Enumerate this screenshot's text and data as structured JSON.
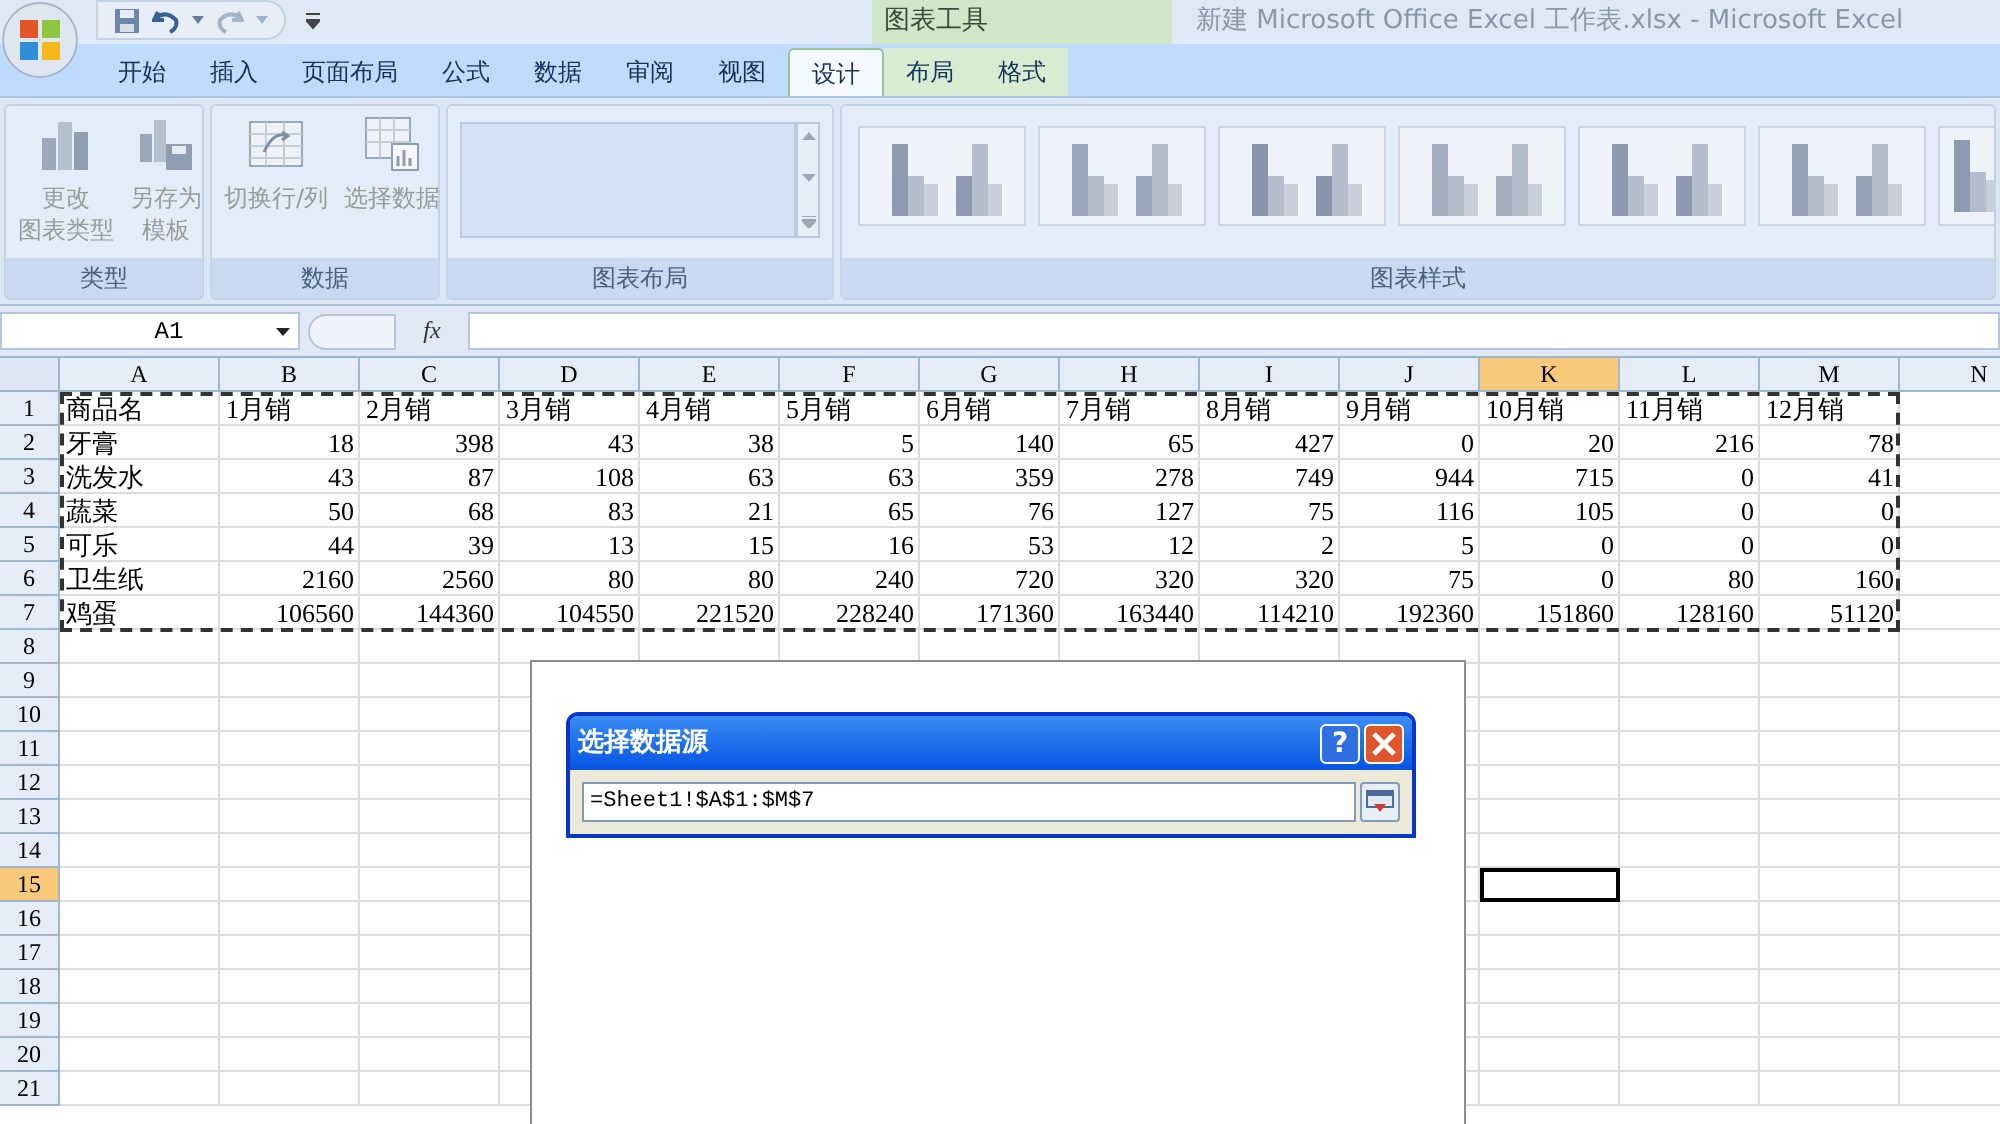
{
  "title_bar": {
    "context_group": "图表工具",
    "title": "新建 Microsoft Office Excel 工作表.xlsx - Microsoft Excel"
  },
  "tabs": [
    {
      "label": "开始",
      "selected": false,
      "kind": "main"
    },
    {
      "label": "插入",
      "selected": false,
      "kind": "main"
    },
    {
      "label": "页面布局",
      "selected": false,
      "kind": "main"
    },
    {
      "label": "公式",
      "selected": false,
      "kind": "main"
    },
    {
      "label": "数据",
      "selected": false,
      "kind": "main"
    },
    {
      "label": "审阅",
      "selected": false,
      "kind": "main"
    },
    {
      "label": "视图",
      "selected": false,
      "kind": "main"
    },
    {
      "label": "设计",
      "selected": true,
      "kind": "contextual"
    },
    {
      "label": "布局",
      "selected": false,
      "kind": "contextual"
    },
    {
      "label": "格式",
      "selected": false,
      "kind": "contextual"
    }
  ],
  "ribbon_groups": [
    {
      "label": "类型",
      "kind": "buttons",
      "buttons": [
        {
          "lines": [
            "更改",
            "图表类型"
          ]
        },
        {
          "lines": [
            "另存为",
            "模板"
          ]
        }
      ]
    },
    {
      "label": "数据",
      "kind": "buttons",
      "buttons": [
        {
          "lines": [
            "切换行/列"
          ]
        },
        {
          "lines": [
            "选择数据"
          ]
        }
      ]
    },
    {
      "label": "图表布局",
      "kind": "layout_gallery"
    },
    {
      "label": "图表样式",
      "kind": "style_gallery"
    }
  ],
  "formula_bar": {
    "name_box": "A1",
    "function_label": "fx"
  },
  "columns": [
    {
      "label": "A",
      "selected": false
    },
    {
      "label": "B",
      "selected": false
    },
    {
      "label": "C",
      "selected": false
    },
    {
      "label": "D",
      "selected": false
    },
    {
      "label": "E",
      "selected": false
    },
    {
      "label": "F",
      "selected": false
    },
    {
      "label": "G",
      "selected": false
    },
    {
      "label": "H",
      "selected": false
    },
    {
      "label": "I",
      "selected": false
    },
    {
      "label": "J",
      "selected": false
    },
    {
      "label": "K",
      "selected": true
    },
    {
      "label": "L",
      "selected": false
    },
    {
      "label": "M",
      "selected": false
    },
    {
      "label": "N",
      "selected": false
    }
  ],
  "rows": [
    {
      "label": "1",
      "selected": false,
      "cells": [
        "商品名",
        "1月销",
        "2月销",
        "3月销",
        "4月销",
        "5月销",
        "6月销",
        "7月销",
        "8月销",
        "9月销",
        "10月销",
        "11月销",
        "12月销"
      ]
    },
    {
      "label": "2",
      "selected": false,
      "cells": [
        "牙膏",
        "18",
        "398",
        "43",
        "38",
        "5",
        "140",
        "65",
        "427",
        "0",
        "20",
        "216",
        "78"
      ]
    },
    {
      "label": "3",
      "selected": false,
      "cells": [
        "洗发水",
        "43",
        "87",
        "108",
        "63",
        "63",
        "359",
        "278",
        "749",
        "944",
        "715",
        "0",
        "41"
      ]
    },
    {
      "label": "4",
      "selected": false,
      "cells": [
        "蔬菜",
        "50",
        "68",
        "83",
        "21",
        "65",
        "76",
        "127",
        "75",
        "116",
        "105",
        "0",
        "0"
      ]
    },
    {
      "label": "5",
      "selected": false,
      "cells": [
        "可乐",
        "44",
        "39",
        "13",
        "15",
        "16",
        "53",
        "12",
        "2",
        "5",
        "0",
        "0",
        "0"
      ]
    },
    {
      "label": "6",
      "selected": false,
      "cells": [
        "卫生纸",
        "2160",
        "2560",
        "80",
        "80",
        "240",
        "720",
        "320",
        "320",
        "75",
        "0",
        "80",
        "160"
      ]
    },
    {
      "label": "7",
      "selected": false,
      "cells": [
        "鸡蛋",
        "106560",
        "144360",
        "104550",
        "221520",
        "228240",
        "171360",
        "163440",
        "114210",
        "192360",
        "151860",
        "128160",
        "51120"
      ]
    },
    {
      "label": "8",
      "selected": false
    },
    {
      "label": "9",
      "selected": false
    },
    {
      "label": "10",
      "selected": false
    },
    {
      "label": "11",
      "selected": false
    },
    {
      "label": "12",
      "selected": false
    },
    {
      "label": "13",
      "selected": false
    },
    {
      "label": "14",
      "selected": false
    },
    {
      "label": "15",
      "selected": true
    },
    {
      "label": "16",
      "selected": false
    },
    {
      "label": "17",
      "selected": false
    },
    {
      "label": "18",
      "selected": false
    },
    {
      "label": "19",
      "selected": false
    },
    {
      "label": "20",
      "selected": false
    },
    {
      "label": "21",
      "selected": false
    }
  ],
  "dialog": {
    "title": "选择数据源",
    "help_button": "?",
    "range": "=Sheet1!$A$1:$M$7"
  }
}
